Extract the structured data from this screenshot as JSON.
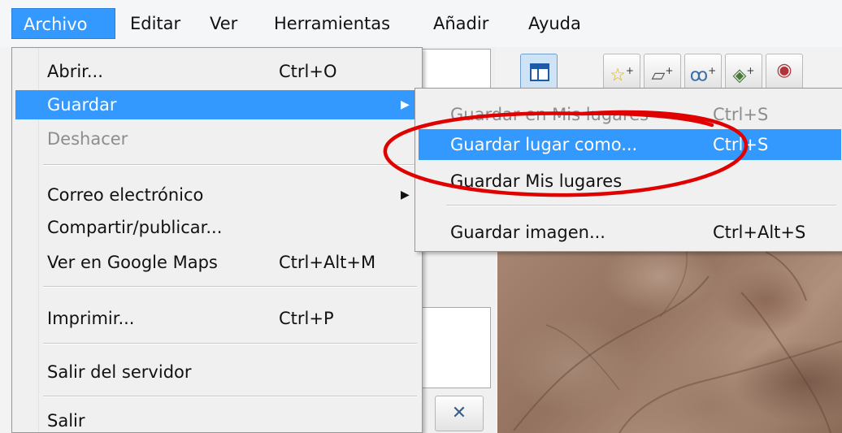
{
  "menubar": {
    "items": [
      {
        "label": "Archivo"
      },
      {
        "label": "Editar"
      },
      {
        "label": "Ver"
      },
      {
        "label": "Herramientas"
      },
      {
        "label": "Añadir"
      },
      {
        "label": "Ayuda"
      }
    ],
    "active_index": 0
  },
  "file_menu": {
    "items": [
      {
        "label": "Abrir...",
        "shortcut": "Ctrl+O"
      },
      {
        "label": "Guardar",
        "submenu_arrow": "▶"
      },
      {
        "label": "Deshacer"
      },
      {
        "label": "Correo electrónico",
        "submenu_arrow": "▶"
      },
      {
        "label": "Compartir/publicar..."
      },
      {
        "label": "Ver en Google Maps",
        "shortcut": "Ctrl+Alt+M"
      },
      {
        "label": "Imprimir...",
        "shortcut": "Ctrl+P"
      },
      {
        "label": "Salir del servidor"
      },
      {
        "label": "Salir"
      }
    ]
  },
  "save_submenu": {
    "items": [
      {
        "label": "Guardar en Mis lugares",
        "shortcut": "Ctrl+S"
      },
      {
        "label": "Guardar lugar como...",
        "shortcut": "Ctrl+S"
      },
      {
        "label": "Guardar Mis lugares"
      },
      {
        "label": "Guardar imagen...",
        "shortcut": "Ctrl+Alt+S"
      }
    ]
  },
  "toolbar": {
    "close_glyph": "✕",
    "buttons": [
      {
        "icon": "layout-icon"
      },
      {
        "icon": "placemark-add-icon",
        "glyph": "☆",
        "badge": "+"
      },
      {
        "icon": "polygon-add-icon",
        "glyph": "▱",
        "badge": "+"
      },
      {
        "icon": "path-add-icon",
        "glyph": "ꝏ",
        "badge": "+"
      },
      {
        "icon": "overlay-add-icon",
        "glyph": "◈",
        "badge": "+"
      },
      {
        "icon": "tour-record-icon",
        "glyph": "◉",
        "badge": ""
      }
    ]
  },
  "colors": {
    "highlight": "#3399ff",
    "annotation": "#e00000",
    "disabled_text": "#8d8d8d"
  }
}
